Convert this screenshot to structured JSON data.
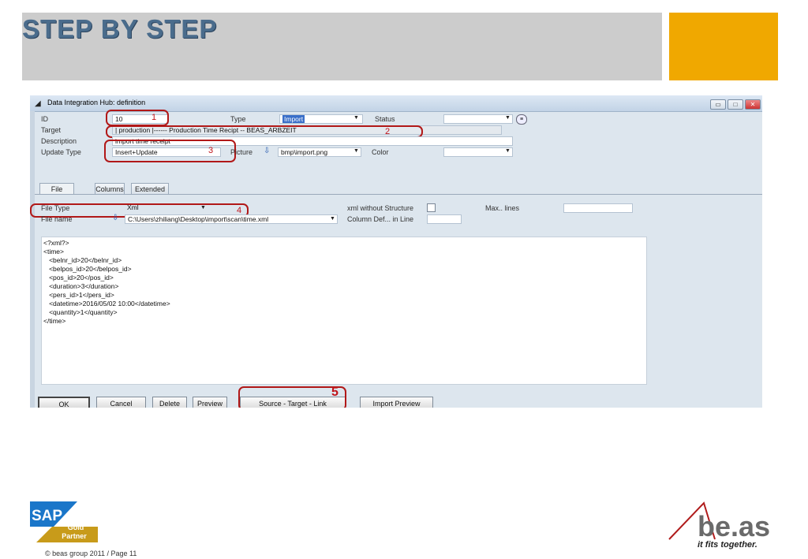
{
  "slide": {
    "title": "STEP BY STEP",
    "footer": "© beas group 2011 / Page 11"
  },
  "window": {
    "title": "Data Integration Hub: definition",
    "controls": {
      "minimize": "▭",
      "maximize": "□",
      "close": "✕"
    }
  },
  "form": {
    "id_label": "ID",
    "id_value": "10",
    "type_label": "Type",
    "type_value": "Import",
    "status_label": "Status",
    "status_value": "",
    "target_label": "Target",
    "target_value": "| production |------ Production Time Recipt -- BEAS_ARBZEIT",
    "description_label": "Description",
    "description_value": "import time receipt",
    "update_type_label": "Update Type",
    "update_type_value": "Insert+Update",
    "picture_label": "Picture",
    "picture_value": "bmp\\import.png",
    "color_label": "Color",
    "color_value": ""
  },
  "tabs": [
    "File",
    "Columns",
    "Extended"
  ],
  "file_tab": {
    "file_type_label": "File Type",
    "file_type_value": "Xml",
    "file_name_label": "File name",
    "file_name_value": "C:\\Users\\zhiliang\\Desktop\\import\\scan\\time.xml",
    "xml_without_structure_label": "xml without Structure",
    "column_def_label": "Column Def... in Line",
    "column_def_value": "",
    "max_lines_label": "Max.. lines",
    "max_lines_value": ""
  },
  "xml_lines": [
    "<?xml?>",
    "<time>",
    "   <belnr_id>20</belnr_id>",
    "   <belpos_id>20</belpos_id>",
    "   <pos_id>20</pos_id>",
    "   <duration>3</duration>",
    "   <pers_id>1</pers_id>",
    "   <datetime>2016/05/02 10:00</datetime>",
    "   <quantity>1</quantity>",
    "</time>"
  ],
  "buttons": {
    "ok": "OK",
    "cancel": "Cancel",
    "delete": "Delete",
    "preview": "Preview",
    "source_target_link": "Source - Target - Link",
    "import_preview": "Import Preview"
  },
  "markers": [
    "1",
    "2",
    "3",
    "4",
    "5"
  ],
  "logos": {
    "sap": "SAP",
    "sap_gold": "Gold",
    "sap_partner": "Partner",
    "beas": "be.as",
    "beas_tagline": "it fits together."
  },
  "colors": {
    "accent": "#f0a800",
    "marker_red": "#b11818",
    "title_blue": "#4a6c8c"
  }
}
